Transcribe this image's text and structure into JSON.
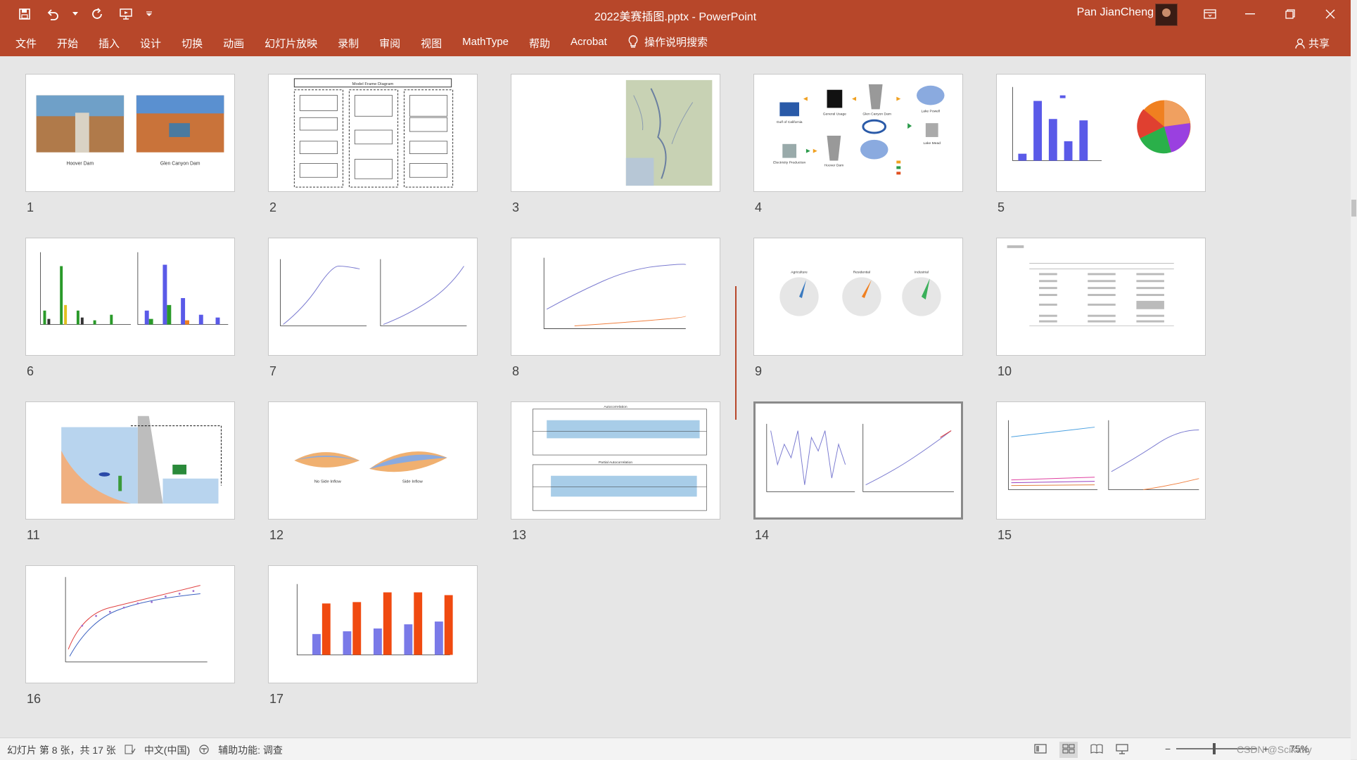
{
  "titlebar": {
    "title": "2022美赛插图.pptx - PowerPoint",
    "user": "Pan JianCheng",
    "qat_icons": [
      "save-icon",
      "undo-icon",
      "undo-dropdown-icon",
      "redo-icon",
      "present-icon",
      "customize-qat-icon"
    ]
  },
  "ribbon": {
    "tabs": [
      "文件",
      "开始",
      "插入",
      "设计",
      "切换",
      "动画",
      "幻灯片放映",
      "录制",
      "审阅",
      "视图",
      "MathType",
      "帮助",
      "Acrobat"
    ],
    "search": "操作说明搜索",
    "share": "共享"
  },
  "slides": [
    {
      "number": "1",
      "title": "",
      "labels": [
        "Hoover Dam",
        "Glen Canyon Dam"
      ]
    },
    {
      "number": "2",
      "title": "Model Frame Diagram"
    },
    {
      "number": "3"
    },
    {
      "number": "4",
      "labels": [
        "Gulf of California",
        "General Usage",
        "Glen Canyon Dam",
        "Lake Powell",
        "Electricity Production",
        "Hoover Dam",
        "Lake Mead"
      ]
    },
    {
      "number": "5"
    },
    {
      "number": "6"
    },
    {
      "number": "7"
    },
    {
      "number": "8"
    },
    {
      "number": "9",
      "labels": [
        "Agriculture",
        "Residential",
        "Industrial"
      ]
    },
    {
      "number": "10"
    },
    {
      "number": "11"
    },
    {
      "number": "12",
      "labels": [
        "No Side Inflow",
        "Side Inflow"
      ]
    },
    {
      "number": "13",
      "labels": [
        "Autocorrelation",
        "Partial Autocorrelation"
      ]
    },
    {
      "number": "14",
      "selected": true
    },
    {
      "number": "15"
    },
    {
      "number": "16"
    },
    {
      "number": "17"
    }
  ],
  "statusbar": {
    "slide_info": "幻灯片 第 8 张，共 17 张",
    "language": "中文(中国)",
    "accessibility": "辅助功能: 调查",
    "zoom": "75%",
    "watermark": "CSDN @Scikatty"
  },
  "colors": {
    "accent": "#b7472a",
    "status_bg": "#f3f3f3",
    "content_bg": "#e6e6e6"
  }
}
